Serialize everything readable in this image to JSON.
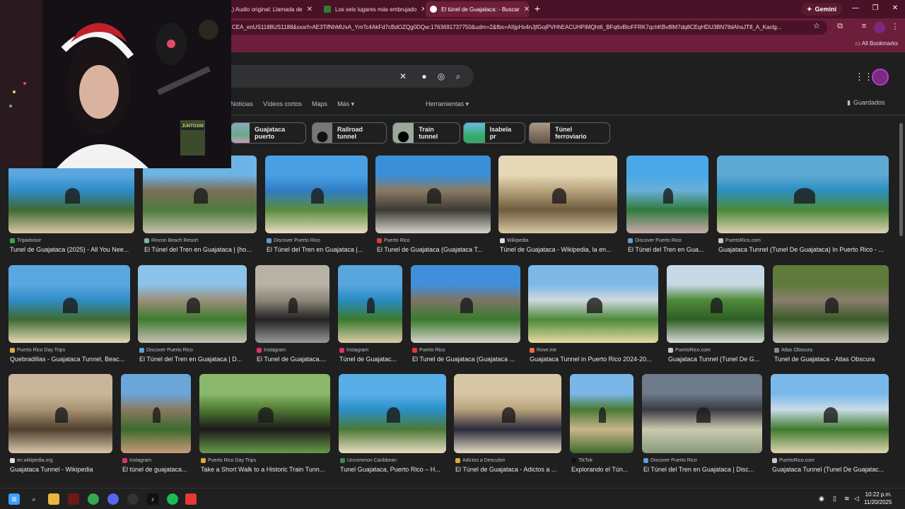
{
  "tabs": [
    {
      "label": "1) Audio original: Llamada de",
      "favicon_color": "#c4302b"
    },
    {
      "label": "Los seis lugares más embrujado",
      "favicon_color": "#2e7d32"
    },
    {
      "label": "El túnel de Guajataca: - Buscar",
      "favicon_color": "#ffffff",
      "active": true
    }
  ],
  "gemini_label": "Gemini",
  "url": "CEA_enUS1188US1188&sxsrf=AE3TifNhMUxA_YmTc4AkFd7cBdOZQg0DQw:1763691737750&udm=2&fbs=AIIjpHx4nJjfGojPVHhEACUHPiMQht6_BFq6vBIoFFRK7qchKBv8lM7dq8CEqHDU3BN7IblAhsJT8_A_Kaclg...",
  "all_bookmarks": "All Bookmarks",
  "nav_items": [
    "Noticias",
    "Vídeos cortos",
    "Maps",
    "Más"
  ],
  "tools_label": "Herramientas",
  "saved_label": "Guardados",
  "chips": [
    {
      "label": "Guajataca puerto"
    },
    {
      "label": "Railroad tunnel"
    },
    {
      "label": "Train tunnel"
    },
    {
      "label": "Isabela pr"
    },
    {
      "label": "Túnel ferroviario"
    }
  ],
  "results": [
    {
      "source": "Tripadvisor",
      "title": "Tunel de Guajataca (2025) - All You Nee...",
      "src_color": "#34a853"
    },
    {
      "source": "Rincon Beach Resort",
      "title": "El Túnel del Tren en Guajataca | {ho...",
      "src_color": "#7fb3a6"
    },
    {
      "source": "Discover Puerto Rico",
      "title": "El Túnel del Tren en Guajataca |...",
      "src_color": "#5aa0d8"
    },
    {
      "source": "Puerto Rico",
      "title": "El Tunel de Guajataca (Guajataca T...",
      "src_color": "#e0383e"
    },
    {
      "source": "Wikipedia",
      "title": "Túnel de Guajataca - Wikipedia, la en...",
      "src_color": "#dddddd"
    },
    {
      "source": "Discover Puerto Rico",
      "title": "El Túnel del Tren en Gua...",
      "src_color": "#5aa0d8"
    },
    {
      "source": "PuertoRico.com",
      "title": "Guajataca Tunnel (Tunel De Guajataca) In Puerto Rico - ...",
      "src_color": "#c8c8c8"
    },
    {
      "source": "Puerto Rico Day Trips",
      "title": "Quebradillas - Guajataca Tunnel, Beac...",
      "src_color": "#e6a93a"
    },
    {
      "source": "Discover Puerto Rico",
      "title": "El Túnel del Tren en Guajataca | D...",
      "src_color": "#5aa0d8"
    },
    {
      "source": "Instagram",
      "title": "El Tunel de Guajataca....",
      "src_color": "#e1306c"
    },
    {
      "source": "Instagram",
      "title": "Túnel de Guajatac...",
      "src_color": "#e1306c"
    },
    {
      "source": "Puerto Rico",
      "title": "El Tunel de Guajataca (Guajataca ...",
      "src_color": "#e0383e"
    },
    {
      "source": "Rove.me",
      "title": "Guajataca Tunnel in Puerto Rico 2024-20...",
      "src_color": "#f26b3a"
    },
    {
      "source": "PuertoRico.com",
      "title": "Guajataca Tunnel (Tunel De G...",
      "src_color": "#c8c8c8"
    },
    {
      "source": "Atlas Obscura",
      "title": "Tunel de Guajataca - Atlas Obscura",
      "src_color": "#888888"
    },
    {
      "source": "en.wikipedia.org",
      "title": "Guajataca Tunnel - Wikipedia",
      "src_color": "#dddddd"
    },
    {
      "source": "Instagram",
      "title": "El túnel de guajataca...",
      "src_color": "#e1306c"
    },
    {
      "source": "Puerto Rico Day Trips",
      "title": "Take a Short Walk to a Historic Train Tunn...",
      "src_color": "#e6a93a"
    },
    {
      "source": "Uncommon Caribbean",
      "title": "Tunel Guajataca, Puerto Rico – H...",
      "src_color": "#3a8a5a"
    },
    {
      "source": "Adictos a Descubrir",
      "title": "El Túnel de Guajataca - Adictos a ...",
      "src_color": "#e6a93a"
    },
    {
      "source": "TikTok",
      "title": "Explorando el Tún...",
      "src_color": "#111111"
    },
    {
      "source": "Discover Puerto Rico",
      "title": "El Túnel del Tren en Guajataca | Disc...",
      "src_color": "#5aa0d8"
    },
    {
      "source": "PuertoRico.com",
      "title": "Guajataca Tunnel (Tunel De Guajatac...",
      "src_color": "#c8c8c8"
    }
  ],
  "webcam_tag": "JUNTOS08",
  "clock": {
    "time": "10:22 p.m.",
    "date": "11/20/2025"
  },
  "taskbar_icons": [
    "windows-start-icon",
    "search-icon",
    "file-explorer-icon",
    "app-icon",
    "chrome-icon",
    "discord-icon",
    "obs-icon",
    "tiktok-icon",
    "spotify-icon",
    "record-icon"
  ],
  "accent": "#6d1e3a"
}
